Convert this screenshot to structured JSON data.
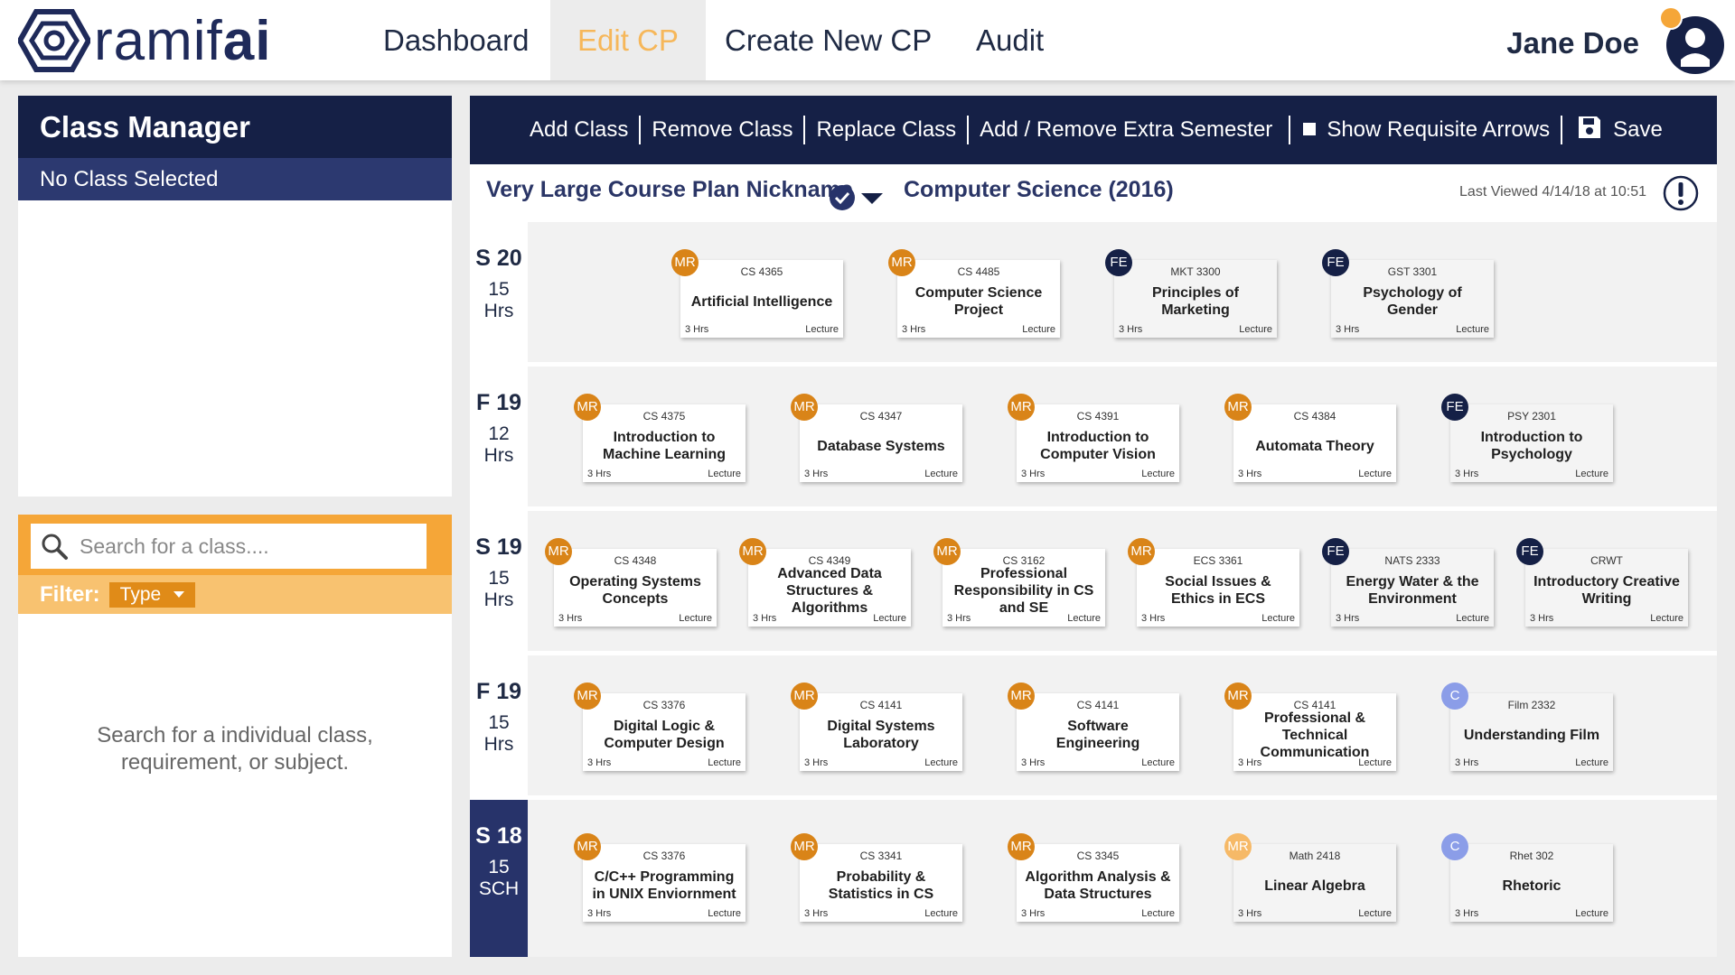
{
  "brand": {
    "logo_light": "ramif",
    "logo_bold": "ai"
  },
  "nav": {
    "dashboard": "Dashboard",
    "edit_cp": "Edit CP",
    "create_cp": "Create New CP",
    "audit": "Audit"
  },
  "user": {
    "name": "Jane Doe"
  },
  "class_manager": {
    "title": "Class Manager",
    "selection": "No Class Selected"
  },
  "search": {
    "placeholder": "Search for a class....",
    "filter_label": "Filter:",
    "filter_value": "Type",
    "hint": "Search for a individual class, requirement, or subject."
  },
  "toolbar": {
    "add": "Add Class",
    "remove": "Remove Class",
    "replace": "Replace Class",
    "extra": "Add / Remove Extra Semester",
    "arrows": "Show Requisite Arrows",
    "save": "Save"
  },
  "plan": {
    "nickname": "Very Large Course Plan Nickname",
    "degree": "Computer Science (2016)",
    "last_viewed": "Last Viewed 4/14/18 at 10:51"
  },
  "colors": {
    "navy": "#152046",
    "orange": "#f5a638",
    "mr_badge": "#d98418",
    "c_badge": "#8b9de8"
  },
  "semesters": [
    {
      "name": "S 20",
      "hours": "15",
      "unit": "Hrs",
      "current": false,
      "classes": [
        {
          "badge": "MR",
          "code": "CS 4365",
          "title": "Artificial Intelligence",
          "hrs": "3 Hrs",
          "type": "Lecture"
        },
        {
          "badge": "MR",
          "code": "CS 4485",
          "title": "Computer Science Project",
          "hrs": "3 Hrs",
          "type": "Lecture"
        },
        {
          "badge": "FE",
          "code": "MKT 3300",
          "title": "Principles of Marketing",
          "hrs": "3 Hrs",
          "type": "Lecture"
        },
        {
          "badge": "FE",
          "code": "GST 3301",
          "title": "Psychology of Gender",
          "hrs": "3 Hrs",
          "type": "Lecture"
        }
      ]
    },
    {
      "name": "F 19",
      "hours": "12",
      "unit": "Hrs",
      "current": false,
      "classes": [
        {
          "badge": "MR",
          "code": "CS 4375",
          "title": "Introduction to Machine Learning",
          "hrs": "3 Hrs",
          "type": "Lecture"
        },
        {
          "badge": "MR",
          "code": "CS 4347",
          "title": "Database Systems",
          "hrs": "3 Hrs",
          "type": "Lecture"
        },
        {
          "badge": "MR",
          "code": "CS 4391",
          "title": "Introduction to Computer Vision",
          "hrs": "3 Hrs",
          "type": "Lecture"
        },
        {
          "badge": "MR",
          "code": "CS 4384",
          "title": "Automata Theory",
          "hrs": "3 Hrs",
          "type": "Lecture"
        },
        {
          "badge": "FE",
          "code": "PSY 2301",
          "title": "Introduction to Psychology",
          "hrs": "3 Hrs",
          "type": "Lecture"
        }
      ]
    },
    {
      "name": "S 19",
      "hours": "15",
      "unit": "Hrs",
      "current": false,
      "classes": [
        {
          "badge": "MR",
          "code": "CS 4348",
          "title": "Operating Systems Concepts",
          "hrs": "3 Hrs",
          "type": "Lecture"
        },
        {
          "badge": "MR",
          "code": "CS 4349",
          "title": "Advanced Data Structures & Algorithms",
          "hrs": "3 Hrs",
          "type": "Lecture"
        },
        {
          "badge": "MR",
          "code": "CS 3162",
          "title": "Professional Responsibility in CS and SE",
          "hrs": "3 Hrs",
          "type": "Lecture"
        },
        {
          "badge": "MR",
          "code": "ECS 3361",
          "title": "Social Issues & Ethics in ECS",
          "hrs": "3 Hrs",
          "type": "Lecture"
        },
        {
          "badge": "FE",
          "code": "NATS 2333",
          "title": "Energy Water & the Environment",
          "hrs": "3 Hrs",
          "type": "Lecture"
        },
        {
          "badge": "FE",
          "code": "CRWT",
          "title": "Introductory Creative Writing",
          "hrs": "3 Hrs",
          "type": "Lecture"
        }
      ]
    },
    {
      "name": "F 19",
      "hours": "15",
      "unit": "Hrs",
      "current": false,
      "classes": [
        {
          "badge": "MR",
          "code": "CS 3376",
          "title": "Digital Logic & Computer Design",
          "hrs": "3 Hrs",
          "type": "Lecture"
        },
        {
          "badge": "MR",
          "code": "CS 4141",
          "title": "Digital Systems Laboratory",
          "hrs": "3 Hrs",
          "type": "Lecture"
        },
        {
          "badge": "MR",
          "code": "CS 4141",
          "title": "Software Engineering",
          "hrs": "3 Hrs",
          "type": "Lecture"
        },
        {
          "badge": "MR",
          "code": "CS 4141",
          "title": "Professional & Technical Communication",
          "hrs": "3 Hrs",
          "type": "Lecture"
        },
        {
          "badge": "C",
          "code": "Film 2332",
          "title": "Understanding Film",
          "hrs": "3 Hrs",
          "type": "Lecture"
        }
      ]
    },
    {
      "name": "S 18",
      "hours": "15",
      "unit": "SCH",
      "current": true,
      "classes": [
        {
          "badge": "MR",
          "code": "CS 3376",
          "title": "C/C++ Programming in UNIX Enviornment",
          "hrs": "3 Hrs",
          "type": "Lecture"
        },
        {
          "badge": "MR",
          "code": "CS 3341",
          "title": "Probability & Statistics in CS",
          "hrs": "3 Hrs",
          "type": "Lecture"
        },
        {
          "badge": "MR",
          "code": "CS 3345",
          "title": "Algorithm Analysis & Data Structures",
          "hrs": "3 Hrs",
          "type": "Lecture"
        },
        {
          "badge": "MR",
          "code": "Math 2418",
          "title": "Linear Algebra",
          "hrs": "3 Hrs",
          "type": "Lecture"
        },
        {
          "badge": "C",
          "code": "Rhet 302",
          "title": "Rhetoric",
          "hrs": "3 Hrs",
          "type": "Lecture"
        }
      ]
    }
  ]
}
